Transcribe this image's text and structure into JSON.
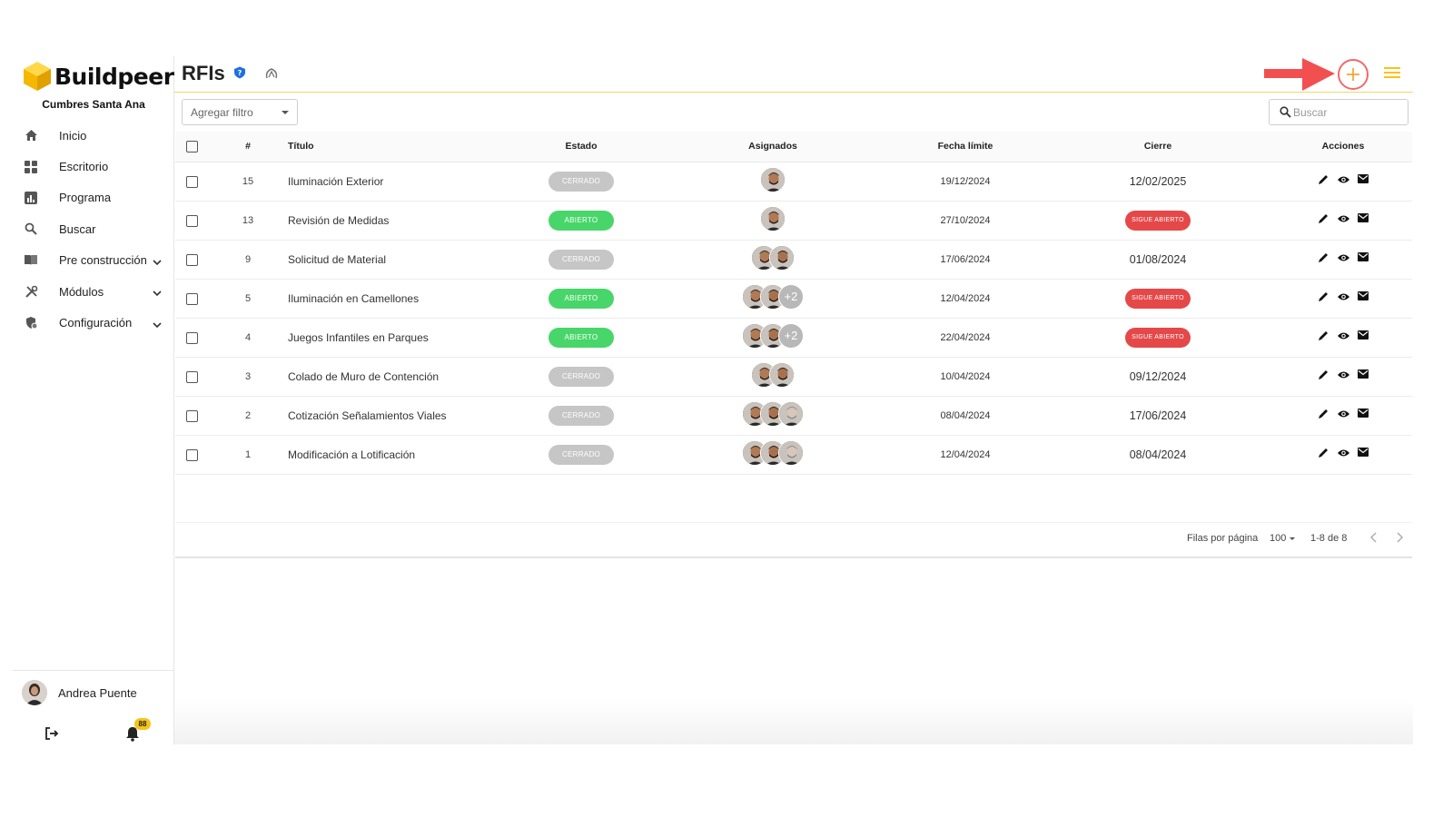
{
  "app": {
    "name": "Buildpeer",
    "project": "Cumbres Santa Ana"
  },
  "nav": [
    {
      "label": "Inicio",
      "icon": "home-icon",
      "expandable": false
    },
    {
      "label": "Escritorio",
      "icon": "dashboard-icon",
      "expandable": false
    },
    {
      "label": "Programa",
      "icon": "chart-icon",
      "expandable": false
    },
    {
      "label": "Buscar",
      "icon": "search-icon",
      "expandable": false
    },
    {
      "label": "Pre construcción",
      "icon": "book-icon",
      "expandable": true
    },
    {
      "label": "Módulos",
      "icon": "tools-icon",
      "expandable": true
    },
    {
      "label": "Configuración",
      "icon": "settings-icon",
      "expandable": true
    }
  ],
  "user": {
    "name": "Andrea Puente",
    "notifications": "88"
  },
  "header": {
    "title": "RFIs"
  },
  "toolbar": {
    "filter_label": "Agregar filtro",
    "search_placeholder": "Buscar"
  },
  "table": {
    "headers": [
      "#",
      "Título",
      "Estado",
      "Asignados",
      "Fecha límite",
      "Cierre",
      "Acciones"
    ],
    "rows": [
      {
        "num": "15",
        "title": "Iluminación Exterior",
        "state": "CERRADO",
        "state_kind": "cerrado",
        "assignees": 1,
        "extra": "",
        "due": "19/12/2024",
        "close": "12/02/2025",
        "close_kind": "date"
      },
      {
        "num": "13",
        "title": "Revisión de Medidas",
        "state": "ABIERTO",
        "state_kind": "abierto",
        "assignees": 1,
        "extra": "",
        "due": "27/10/2024",
        "close": "SIGUE ABIERTO",
        "close_kind": "sigue"
      },
      {
        "num": "9",
        "title": "Solicitud de Material",
        "state": "CERRADO",
        "state_kind": "cerrado",
        "assignees": 2,
        "extra": "",
        "due": "17/06/2024",
        "close": "01/08/2024",
        "close_kind": "date"
      },
      {
        "num": "5",
        "title": "Iluminación en Camellones",
        "state": "ABIERTO",
        "state_kind": "abierto",
        "assignees": 2,
        "extra": "+2",
        "due": "12/04/2024",
        "close": "SIGUE ABIERTO",
        "close_kind": "sigue"
      },
      {
        "num": "4",
        "title": "Juegos Infantiles en Parques",
        "state": "ABIERTO",
        "state_kind": "abierto",
        "assignees": 2,
        "extra": "+2",
        "due": "22/04/2024",
        "close": "SIGUE ABIERTO",
        "close_kind": "sigue"
      },
      {
        "num": "3",
        "title": "Colado de Muro de Contención",
        "state": "CERRADO",
        "state_kind": "cerrado",
        "assignees": 2,
        "extra": "",
        "due": "10/04/2024",
        "close": "09/12/2024",
        "close_kind": "date"
      },
      {
        "num": "2",
        "title": "Cotización Señalamientos Viales",
        "state": "CERRADO",
        "state_kind": "cerrado",
        "assignees": 3,
        "extra": "",
        "due": "08/04/2024",
        "close": "17/06/2024",
        "close_kind": "date"
      },
      {
        "num": "1",
        "title": "Modificación a Lotificación",
        "state": "CERRADO",
        "state_kind": "cerrado",
        "assignees": 3,
        "extra": "",
        "due": "12/04/2024",
        "close": "08/04/2024",
        "close_kind": "date"
      }
    ]
  },
  "pager": {
    "rows_per_page_label": "Filas por página",
    "rows_per_page": "100",
    "range": "1-8 de 8"
  },
  "colors": {
    "accent": "#f5c518",
    "closed": "#c6c6c6",
    "open": "#48d66a",
    "still_open": "#e54848",
    "add_button": "#f06a6a"
  }
}
